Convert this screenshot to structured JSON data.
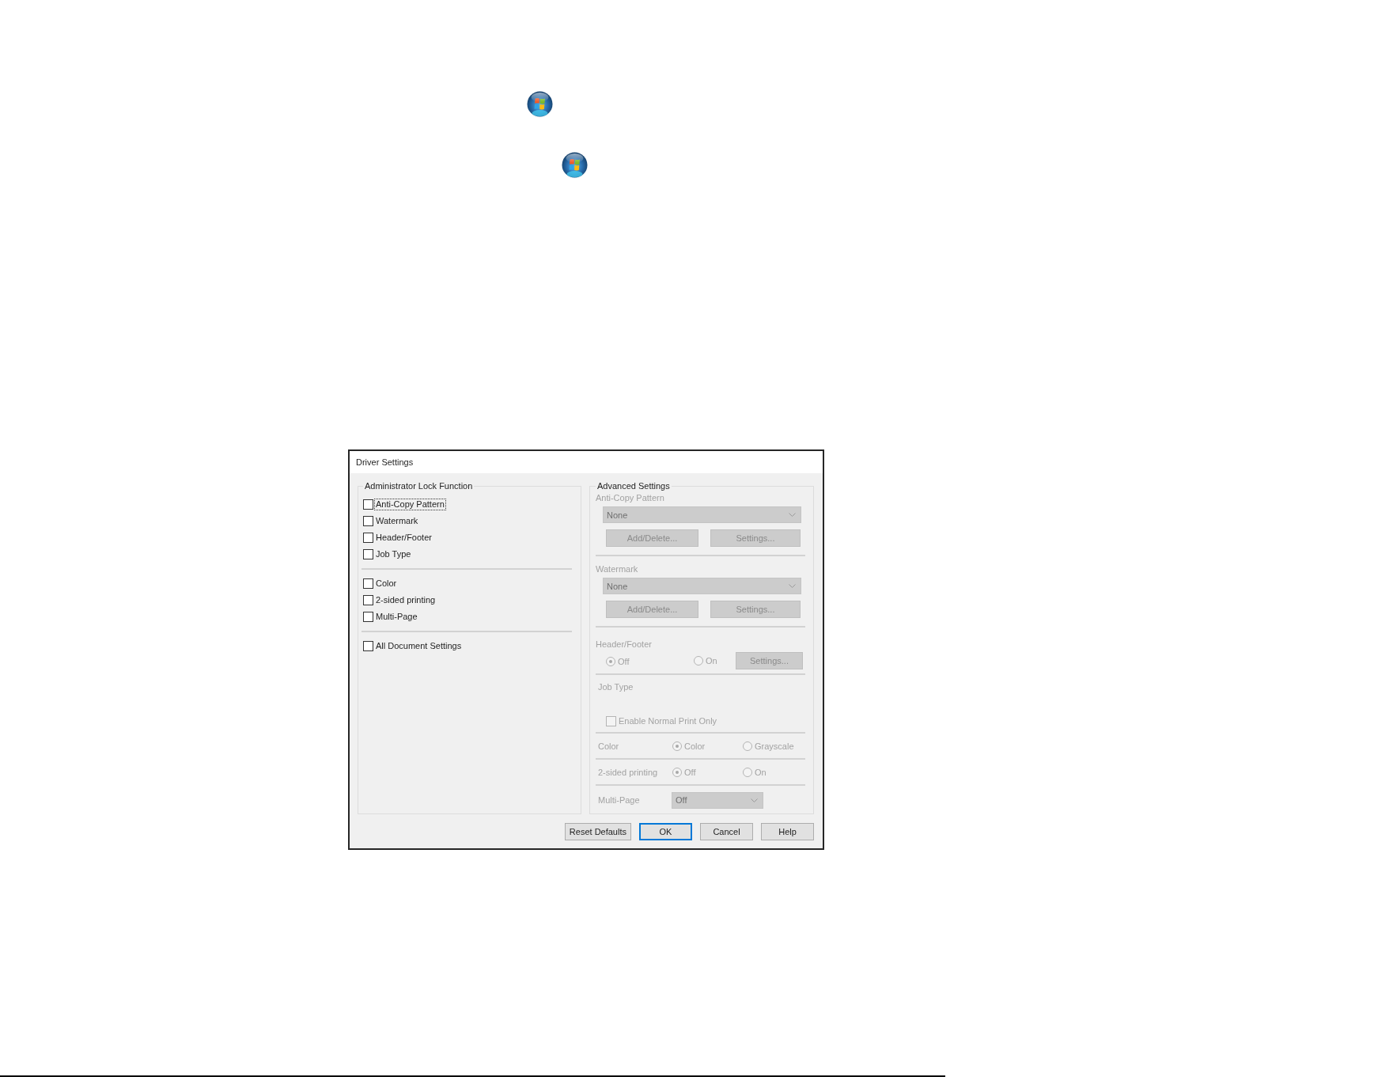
{
  "dialog": {
    "title": "Driver Settings",
    "lock_panel": {
      "title": "Administrator Lock Function",
      "groups": [
        {
          "items": [
            {
              "label": "Anti-Copy Pattern",
              "checked": false,
              "focused": true
            },
            {
              "label": "Watermark",
              "checked": false,
              "focused": false
            },
            {
              "label": "Header/Footer",
              "checked": false,
              "focused": false
            },
            {
              "label": "Job Type",
              "checked": false,
              "focused": false
            }
          ]
        },
        {
          "items": [
            {
              "label": "Color",
              "checked": false,
              "focused": false
            },
            {
              "label": "2-sided printing",
              "checked": false,
              "focused": false
            },
            {
              "label": "Multi-Page",
              "checked": false,
              "focused": false
            }
          ]
        },
        {
          "items": [
            {
              "label": "All Document Settings",
              "checked": false,
              "focused": false
            }
          ]
        }
      ]
    },
    "advanced_panel": {
      "title": "Advanced Settings",
      "disabled": true,
      "sections": [
        {
          "kind": "dropdown_buttons",
          "label": "Anti-Copy Pattern",
          "dropdown": "None",
          "buttons": [
            "Add/Delete...",
            "Settings..."
          ]
        },
        {
          "kind": "dropdown_buttons",
          "label": "Watermark",
          "dropdown": "None",
          "buttons": [
            "Add/Delete...",
            "Settings..."
          ]
        },
        {
          "kind": "radios_button",
          "label": "Header/Footer",
          "options": [
            {
              "label": "Off",
              "selected": true
            },
            {
              "label": "On",
              "selected": false
            }
          ],
          "button": "Settings..."
        },
        {
          "kind": "checkbox",
          "label": "Job Type",
          "checkbox": {
            "label": "Enable Normal Print Only",
            "checked": false
          }
        },
        {
          "kind": "radio_row",
          "label": "Color",
          "options": [
            {
              "label": "Color",
              "selected": true
            },
            {
              "label": "Grayscale",
              "selected": false
            }
          ]
        },
        {
          "kind": "radio_row",
          "label": "2-sided printing",
          "options": [
            {
              "label": "Off",
              "selected": true
            },
            {
              "label": "On",
              "selected": false
            }
          ]
        },
        {
          "kind": "dropdown_row",
          "label": "Multi-Page",
          "dropdown": "Off"
        }
      ]
    },
    "buttons": [
      {
        "label": "Reset Defaults",
        "default": false
      },
      {
        "label": "OK",
        "default": true
      },
      {
        "label": "Cancel",
        "default": false
      },
      {
        "label": "Help",
        "default": false
      }
    ]
  }
}
